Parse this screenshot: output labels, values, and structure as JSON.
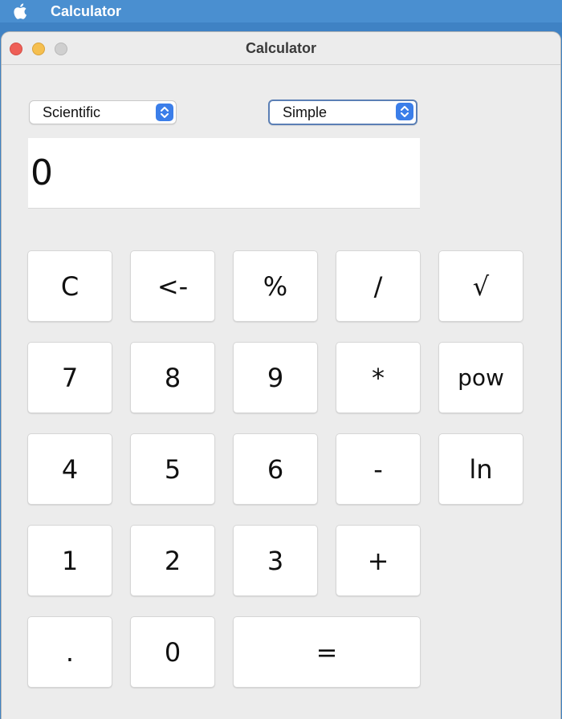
{
  "menubar": {
    "title": "Calculator"
  },
  "window": {
    "title": "Calculator"
  },
  "mode_select": {
    "value": "Scientific"
  },
  "style_select": {
    "value": "Simple"
  },
  "display": {
    "value": "0"
  },
  "keys": {
    "clear": "C",
    "backspace": "<-",
    "percent": "%",
    "divide": "/",
    "sqrt": "√",
    "seven": "7",
    "eight": "8",
    "nine": "9",
    "multiply": "*",
    "pow": "pow",
    "four": "4",
    "five": "5",
    "six": "6",
    "subtract": "-",
    "ln": "ln",
    "one": "1",
    "two": "2",
    "three": "3",
    "add": "+",
    "decimal": ".",
    "zero": "0",
    "equals": "="
  },
  "colors": {
    "accent": "#3b7ee9",
    "menubar": "#4a8fd0",
    "window_bg": "#ececec",
    "close": "#ee5f57",
    "minimize": "#f5bf4f"
  }
}
